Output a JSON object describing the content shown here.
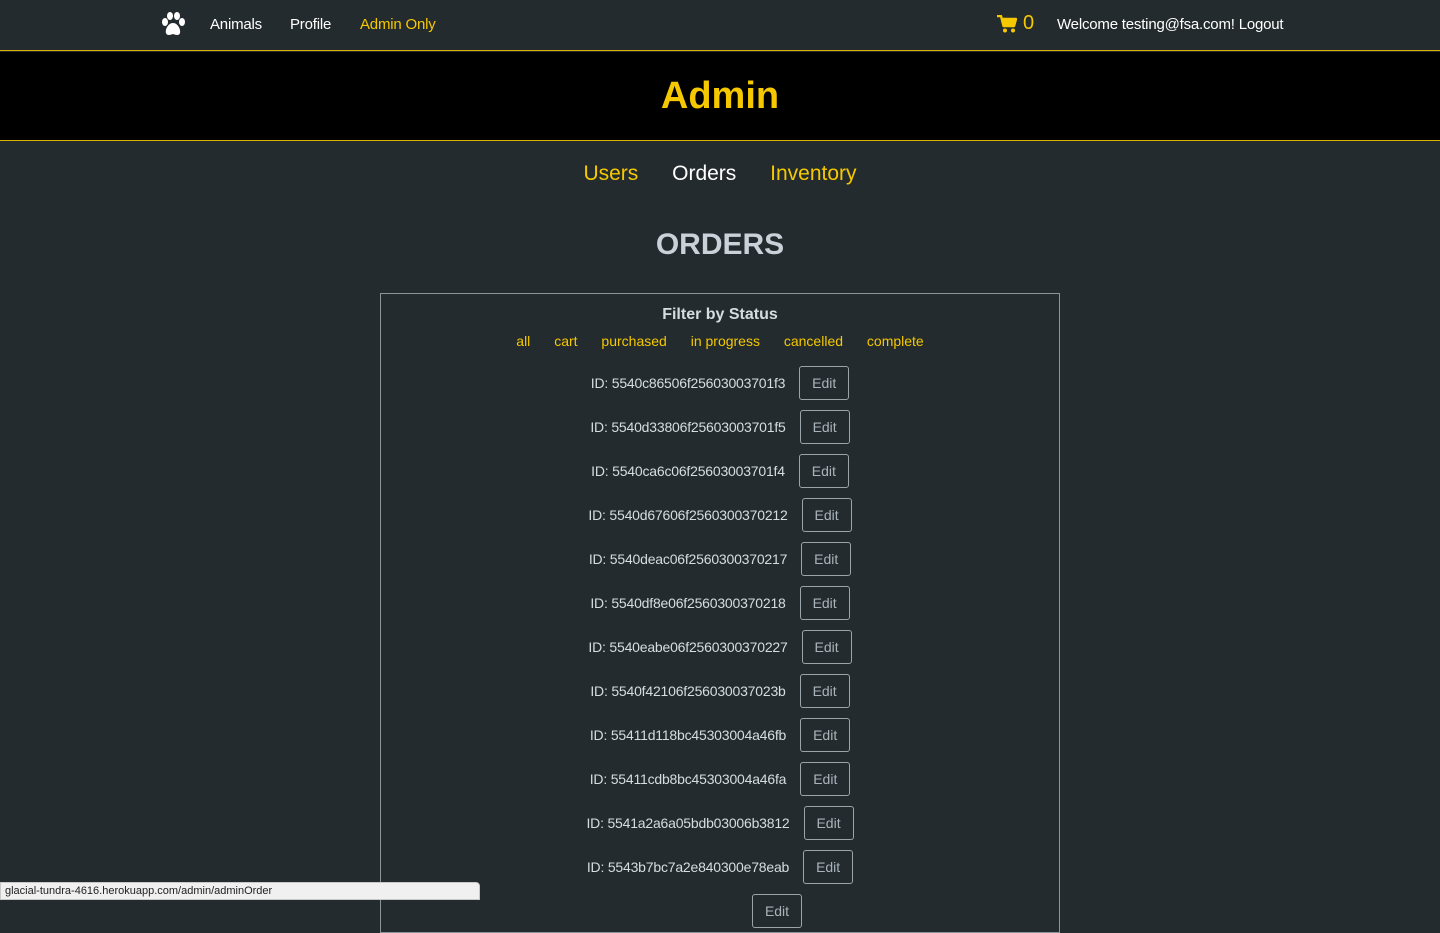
{
  "navbar": {
    "links": [
      {
        "label": "Animals"
      },
      {
        "label": "Profile"
      },
      {
        "label": "Admin Only"
      }
    ],
    "cart_count": "0",
    "welcome_text": "Welcome testing@fsa.com!",
    "logout_label": "Logout",
    "brand_icon": "paw-icon",
    "accent_color": "#f5c800"
  },
  "banner": {
    "title": "Admin"
  },
  "admin_tabs": [
    {
      "label": "Users"
    },
    {
      "label": "Orders"
    },
    {
      "label": "Inventory"
    }
  ],
  "section_title": "ORDERS",
  "filter": {
    "title": "Filter by Status",
    "options": [
      "all",
      "cart",
      "purchased",
      "in progress",
      "cancelled",
      "complete"
    ]
  },
  "orders": [
    {
      "id": "ID: 5540c86506f25603003701f3",
      "action": "Edit"
    },
    {
      "id": "ID: 5540d33806f25603003701f5",
      "action": "Edit"
    },
    {
      "id": "ID: 5540ca6c06f25603003701f4",
      "action": "Edit"
    },
    {
      "id": "ID: 5540d67606f2560300370212",
      "action": "Edit"
    },
    {
      "id": "ID: 5540deac06f2560300370217",
      "action": "Edit"
    },
    {
      "id": "ID: 5540df8e06f2560300370218",
      "action": "Edit"
    },
    {
      "id": "ID: 5540eabe06f2560300370227",
      "action": "Edit"
    },
    {
      "id": "ID: 5540f42106f256030037023b",
      "action": "Edit"
    },
    {
      "id": "ID: 55411d118bc45303004a46fb",
      "action": "Edit"
    },
    {
      "id": "ID: 55411cdb8bc45303004a46fa",
      "action": "Edit"
    },
    {
      "id": "ID: 5541a2a6a05bdb03006b3812",
      "action": "Edit"
    },
    {
      "id": "ID: 5543b7bc7a2e840300e78eab",
      "action": "Edit"
    },
    {
      "id": "",
      "action": "Edit"
    }
  ],
  "status_bar": {
    "url": "glacial-tundra-4616.herokuapp.com/admin/adminOrder"
  }
}
